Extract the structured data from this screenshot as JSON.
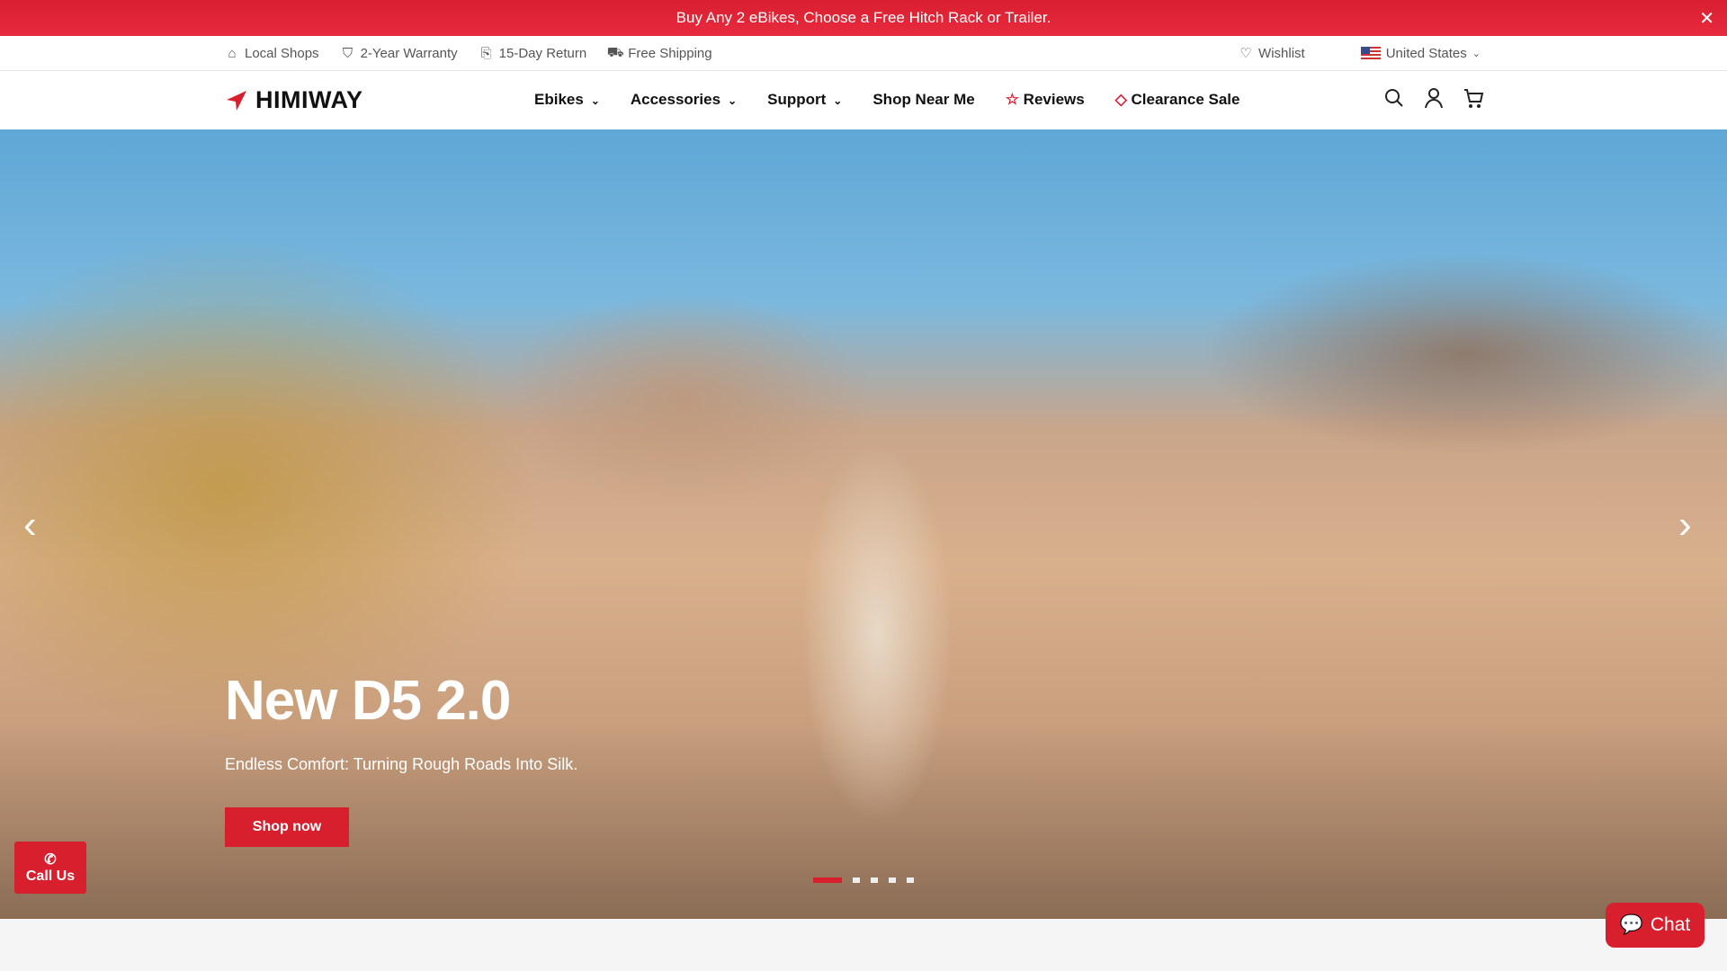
{
  "banner": {
    "text": "Buy Any 2 eBikes, Choose a Free Hitch Rack or Trailer.",
    "close": "✕"
  },
  "topbar": {
    "items": [
      "Local Shops",
      "2-Year Warranty",
      "15-Day Return",
      "Free Shipping"
    ],
    "wishlist": "Wishlist",
    "country": "United States"
  },
  "nav": {
    "logo": "HIMIWAY",
    "items": [
      "Ebikes",
      "Accessories",
      "Support",
      "Shop Near Me",
      "Reviews",
      "Clearance Sale"
    ]
  },
  "hero": {
    "title": "New D5 2.0",
    "subtitle": "Endless Comfort: Turning Rough Roads Into Silk.",
    "cta": "Shop now",
    "slides": 5,
    "active_slide": 1
  },
  "call": "Call Us",
  "chat": "Chat",
  "colors": {
    "accent": "#d71f2e"
  }
}
